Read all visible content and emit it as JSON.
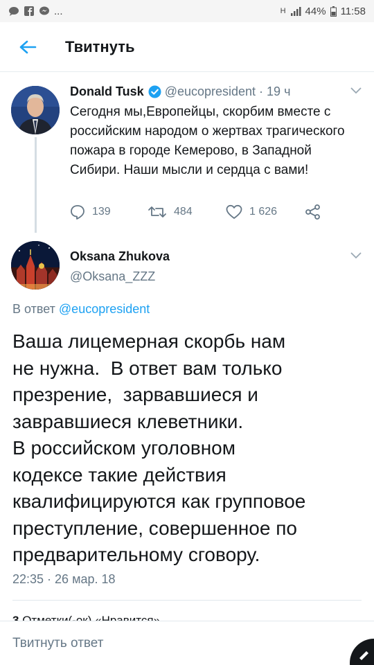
{
  "status_bar": {
    "network": "H",
    "battery": "44%",
    "time": "11:58",
    "more": "..."
  },
  "app_bar": {
    "title": "Твитнуть"
  },
  "tweet1": {
    "name": "Donald Tusk",
    "handle": "@eucopresident",
    "separator": "·",
    "time": "19 ч",
    "body": "Сегодня мы,Европейцы, скорбим вместе с российским народом о жертвах трагического пожара в городе Кемерово, в Западной Сибири. Наши мысли и сердца с вами!",
    "replies": "139",
    "retweets": "484",
    "likes": "1 626"
  },
  "tweet2": {
    "name": "Oksana Zhukova",
    "handle": "@Oksana_ZZZ",
    "reply_prefix": "В ответ",
    "reply_to": "@eucopresident",
    "body_lines": [
      "Ваша лицемерная скорбь нам",
      "не нужна.  В ответ вам только",
      "презрение,  зарвавшиеся и",
      "завравшиеся клеветники.",
      "В российском уголовном",
      "кодексе такие действия",
      "квалифицируются как групповое",
      "преступление, совершенное по",
      "предварительному сговору."
    ],
    "timestamp": "22:35 · 26 мар. 18",
    "counts_peek_number": "3",
    "counts_peek_text": "Отметки(-ок) «Нравится»"
  },
  "reply_bar": {
    "placeholder": "Твитнуть ответ"
  },
  "colors": {
    "accent": "#1da1f2",
    "secondary_text": "#657786",
    "primary_text": "#14171a",
    "divider": "#e1e8ed"
  },
  "icons": {
    "back": "arrow-left-icon",
    "verified": "verified-badge-icon",
    "reply": "reply-icon",
    "retweet": "retweet-icon",
    "like": "heart-icon",
    "share": "share-icon",
    "menu": "chevron-down-icon"
  }
}
